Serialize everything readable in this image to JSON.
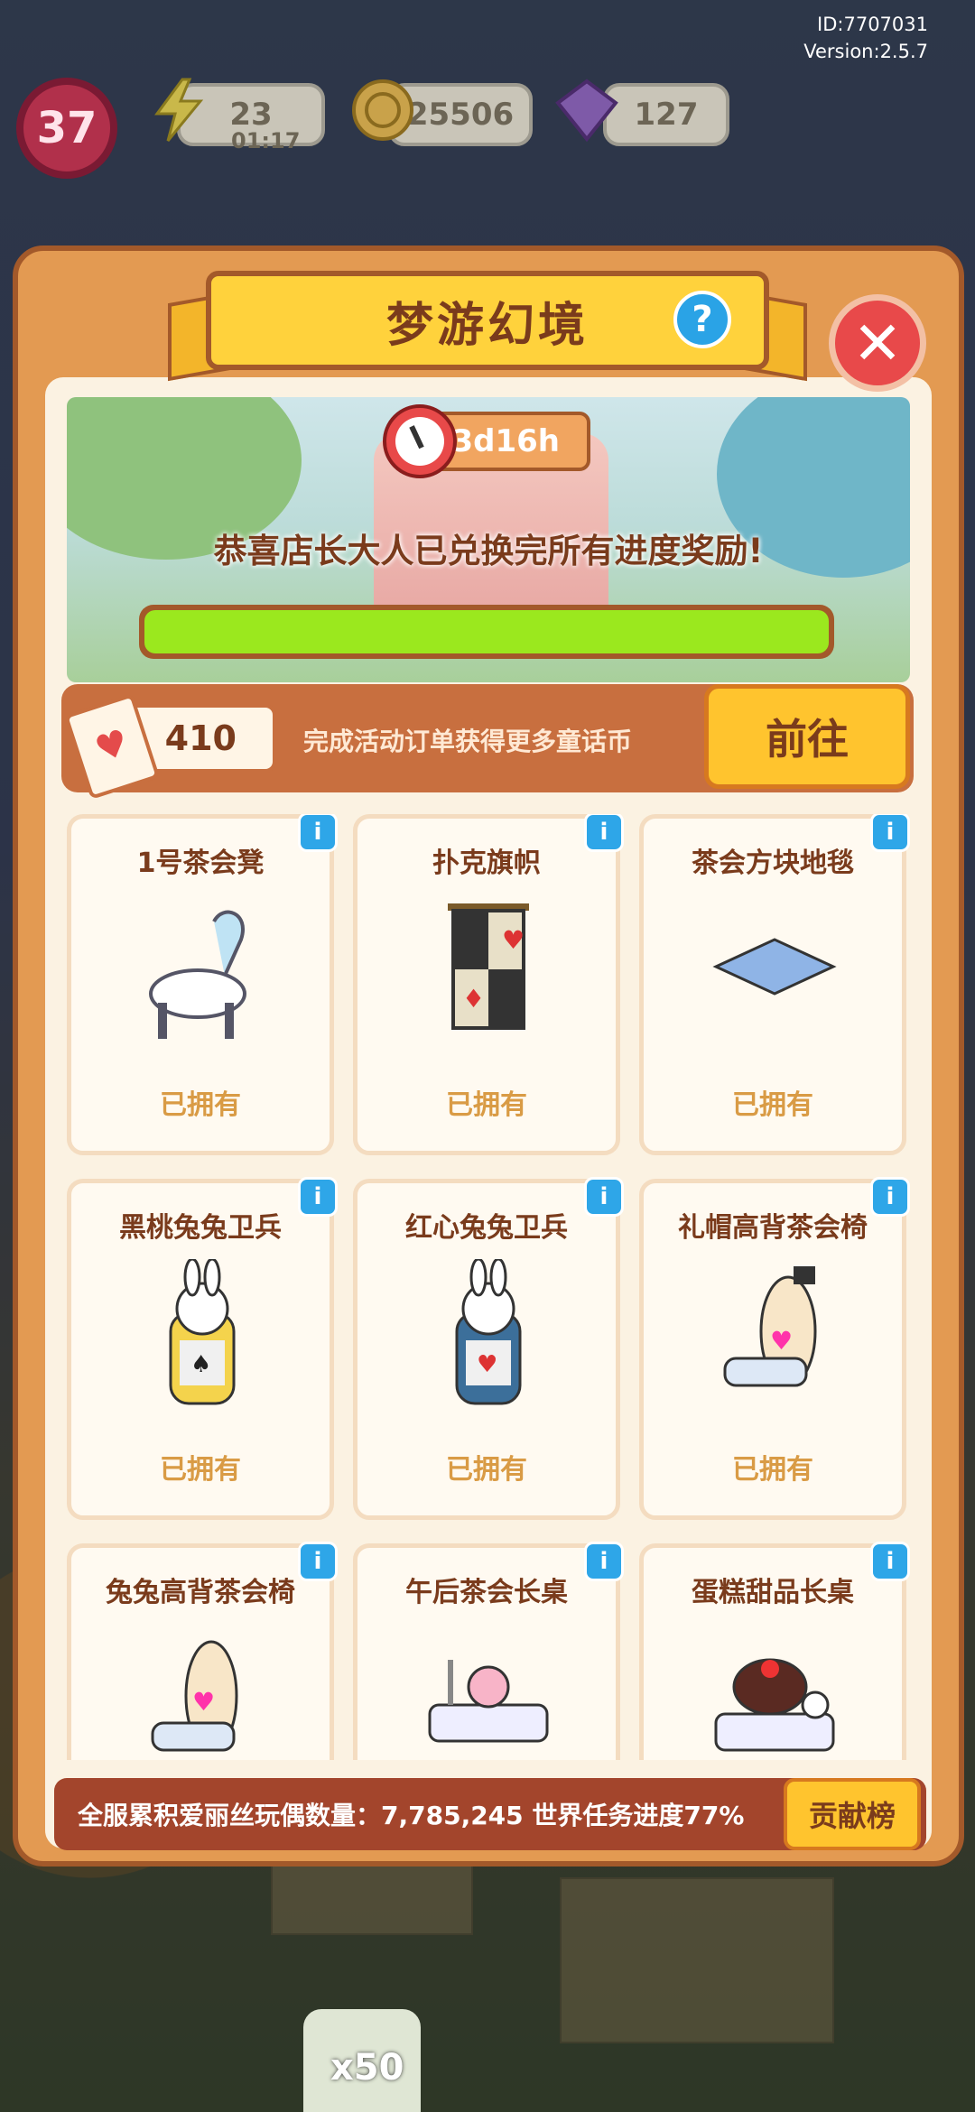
{
  "hud": {
    "id_text": "ID:7707031",
    "version_text": "Version:2.5.7",
    "level": "37",
    "energy": "23",
    "energy_timer": "01:17",
    "coins": "25506",
    "gems": "127"
  },
  "panel": {
    "title": "梦游幻境",
    "help_label": "?",
    "close_label": "✕"
  },
  "banner": {
    "timer": "3d16h",
    "congrats": "恭喜店长大人已兑换完所有进度奖励!",
    "progress": 1.0
  },
  "coin_row": {
    "count": "410",
    "hint": "完成活动订单获得更多童话币",
    "go_label": "前往"
  },
  "items": [
    {
      "name": "1号茶会凳",
      "status": "已拥有"
    },
    {
      "name": "扑克旗帜",
      "status": "已拥有"
    },
    {
      "name": "茶会方块地毯",
      "status": "已拥有"
    },
    {
      "name": "黑桃兔兔卫兵",
      "status": "已拥有"
    },
    {
      "name": "红心兔兔卫兵",
      "status": "已拥有"
    },
    {
      "name": "礼帽高背茶会椅",
      "status": "已拥有"
    },
    {
      "name": "兔兔高背茶会椅",
      "status": ""
    },
    {
      "name": "午后茶会长桌",
      "status": ""
    },
    {
      "name": "蛋糕甜品长桌",
      "status": ""
    }
  ],
  "info_label": "i",
  "footer": {
    "text": "全服累积爱丽丝玩偶数量：7,785,245  世界任务进度77%",
    "rank_label": "贡献榜"
  },
  "bottom": {
    "badge": "x50"
  },
  "colors": {
    "panel": "#e39a52",
    "panel_border": "#a3592a",
    "title_board": "#ffd23c",
    "progress_fill": "#9be81e",
    "go_button": "#ffc42e",
    "info_badge": "#2ea6e8",
    "close_button": "#e8494a"
  }
}
